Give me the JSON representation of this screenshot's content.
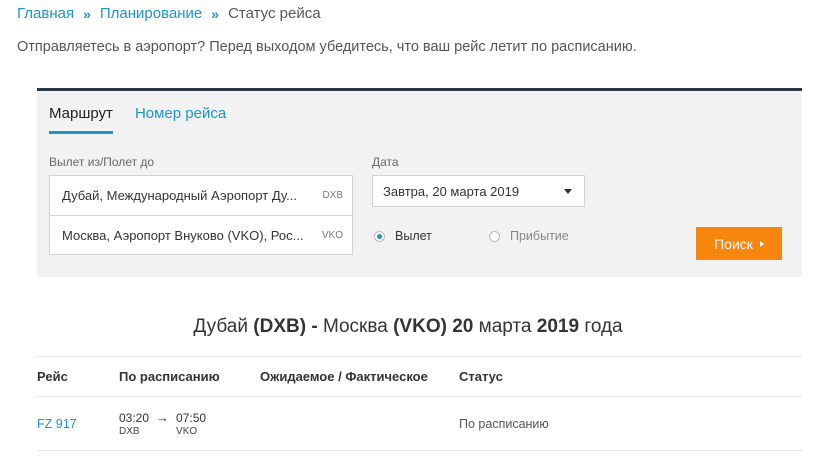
{
  "breadcrumb": {
    "home": "Главная",
    "planning": "Планирование",
    "current": "Статус рейса",
    "separator": "»"
  },
  "intro": "Отправляетесь в аэропорт? Перед выходом убедитесь, что ваш рейс летит по расписанию.",
  "search": {
    "tabs": [
      {
        "label": "Маршрут",
        "active": true
      },
      {
        "label": "Номер рейса",
        "active": false
      }
    ],
    "route_label": "Вылет из/Полет до",
    "from": {
      "value": "Дубай, Международный Аэропорт Ду...",
      "code": "DXB"
    },
    "to": {
      "value": "Москва, Аэропорт Внуково (VKO), Рос...",
      "code": "VKO"
    },
    "date_label": "Дата",
    "date_value": "Завтра, 20 марта 2019",
    "radio_departure": "Вылет",
    "radio_arrival": "Прибытие",
    "selected": "departure",
    "button": "Поиск"
  },
  "result": {
    "from_city": "Дубай",
    "from_code": "(DXB)",
    "dash": "-",
    "to_city": "Москва",
    "to_code": "(VKO)",
    "day": "20",
    "month": "марта",
    "year": "2019",
    "suffix": "года"
  },
  "table": {
    "headers": [
      "Рейс",
      "По расписанию",
      "Ожидаемое / Фактическое",
      "Статус"
    ],
    "rows": [
      {
        "flight": "FZ 917",
        "dep_time": "03:20",
        "dep_code": "DXB",
        "arrow": "→",
        "arr_time": "07:50",
        "arr_code": "VKO",
        "actual": "",
        "status": "По расписанию"
      }
    ]
  },
  "colors": {
    "link": "#1a96c9",
    "button": "#f7860f",
    "panel": "#f2f2f2",
    "panel_border": "#2b3a4a"
  }
}
